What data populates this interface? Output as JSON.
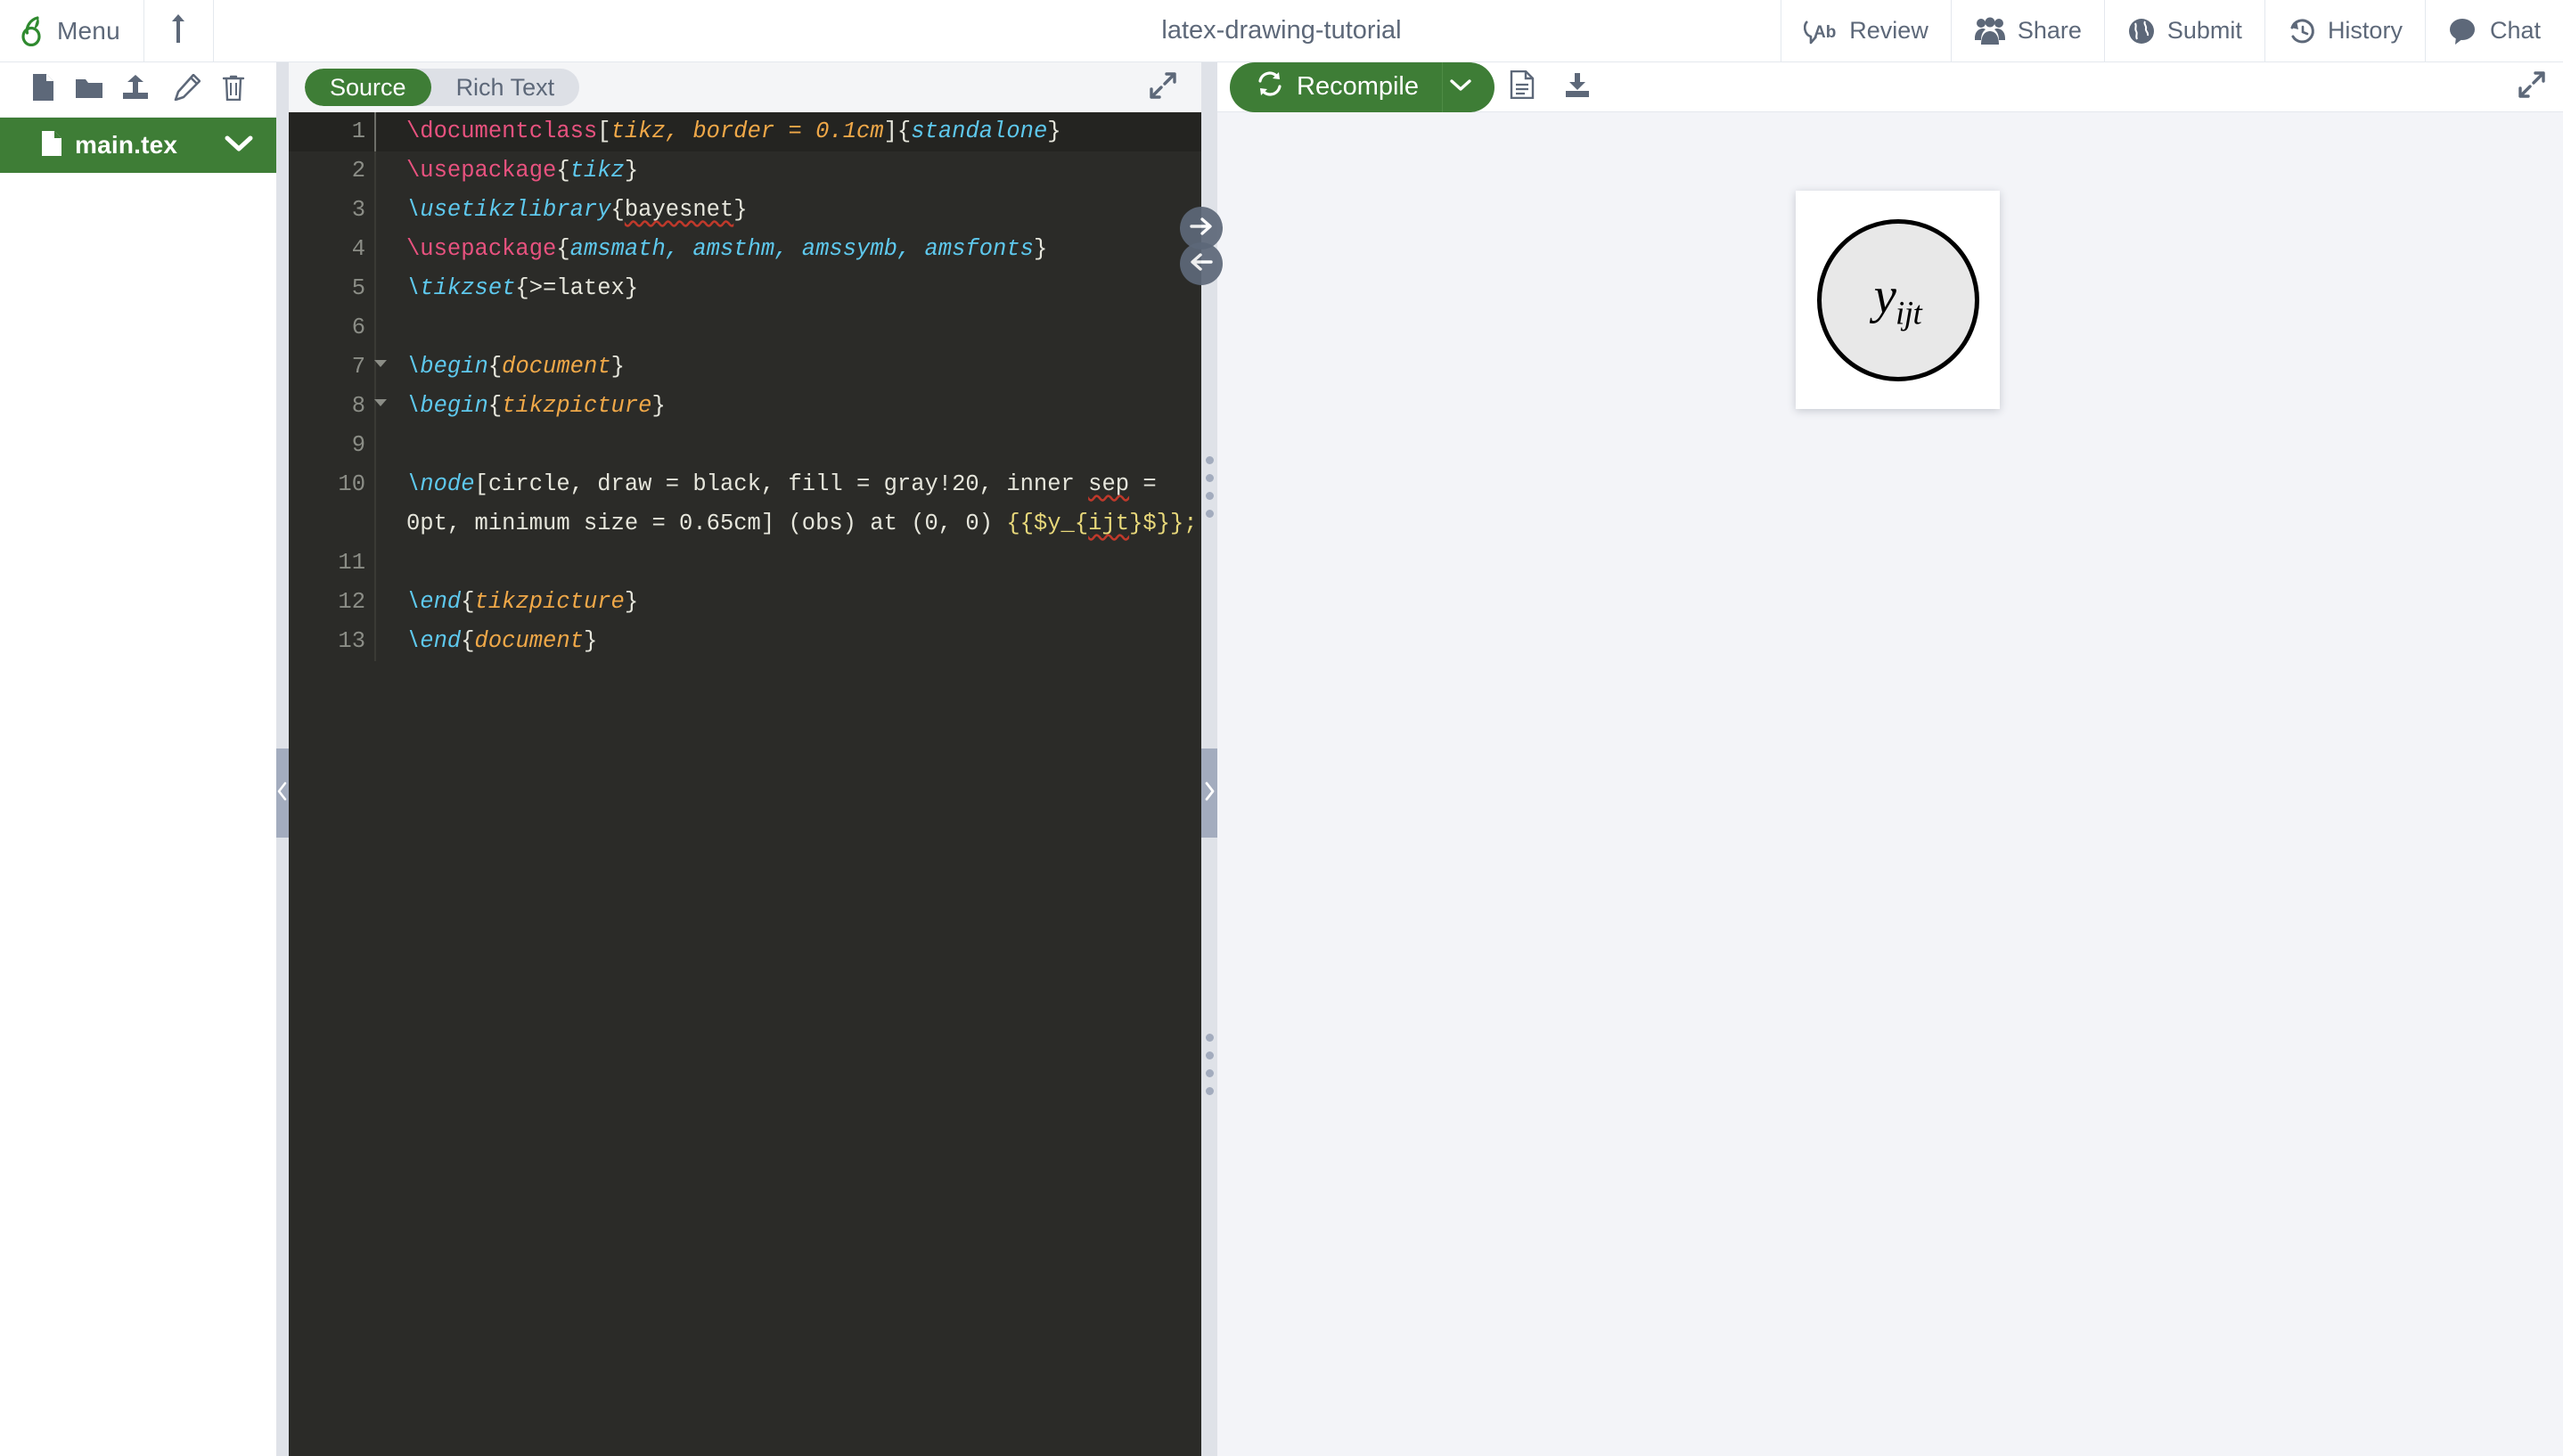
{
  "header": {
    "menu_label": "Menu",
    "project_title": "latex-drawing-tutorial",
    "logo_icon": "overleaf-logo-icon",
    "upload_icon": "upload-arrow-icon",
    "nav_items": [
      {
        "label": "Review",
        "icon": "review-ab-icon"
      },
      {
        "label": "Share",
        "icon": "share-people-icon"
      },
      {
        "label": "Submit",
        "icon": "submit-globe-icon"
      },
      {
        "label": "History",
        "icon": "history-clock-icon"
      },
      {
        "label": "Chat",
        "icon": "chat-bubble-icon"
      }
    ]
  },
  "file_panel": {
    "toolbar_icons": [
      {
        "name": "new-file-icon"
      },
      {
        "name": "new-folder-icon"
      },
      {
        "name": "upload-file-icon"
      },
      {
        "name": "rename-pencil-icon"
      },
      {
        "name": "delete-trash-icon"
      }
    ],
    "files": [
      {
        "name": "main.tex",
        "icon": "file-tex-icon",
        "selected": true
      }
    ]
  },
  "editor": {
    "tabs": [
      {
        "label": "Source",
        "active": true
      },
      {
        "label": "Rich Text",
        "active": false
      }
    ],
    "expand_icon": "expand-diagonal-icon",
    "sync_buttons": [
      {
        "name": "sync-to-pdf-button",
        "icon": "arrow-right-icon"
      },
      {
        "name": "sync-to-code-button",
        "icon": "arrow-left-icon"
      }
    ],
    "lines": [
      {
        "n": "1",
        "fold": false,
        "highlight": true,
        "tokens": [
          {
            "t": "\\documentclass",
            "c": "t-cmd"
          },
          {
            "t": "[",
            "c": "t-plain"
          },
          {
            "t": "tikz, border = 0.1cm",
            "c": "t-arg"
          },
          {
            "t": "]{",
            "c": "t-plain"
          },
          {
            "t": "standalone",
            "c": "t-arg2"
          },
          {
            "t": "}",
            "c": "t-plain"
          }
        ]
      },
      {
        "n": "2",
        "fold": false,
        "highlight": false,
        "tokens": [
          {
            "t": "\\usepackage",
            "c": "t-cmd"
          },
          {
            "t": "{",
            "c": "t-plain"
          },
          {
            "t": "tikz",
            "c": "t-arg2"
          },
          {
            "t": "}",
            "c": "t-plain"
          }
        ]
      },
      {
        "n": "3",
        "fold": false,
        "highlight": false,
        "tokens": [
          {
            "t": "\\usetikzlibrary",
            "c": "t-cmd2"
          },
          {
            "t": "{",
            "c": "t-plain"
          },
          {
            "t": "bayesnet",
            "c": "t-plain squig"
          },
          {
            "t": "}",
            "c": "t-plain"
          }
        ]
      },
      {
        "n": "4",
        "fold": false,
        "highlight": false,
        "tokens": [
          {
            "t": "\\usepackage",
            "c": "t-cmd"
          },
          {
            "t": "{",
            "c": "t-plain"
          },
          {
            "t": "amsmath, amsthm, amssymb, amsfonts",
            "c": "t-arg2"
          },
          {
            "t": "}",
            "c": "t-plain"
          }
        ]
      },
      {
        "n": "5",
        "fold": false,
        "highlight": false,
        "tokens": [
          {
            "t": "\\tikzset",
            "c": "t-cmd2"
          },
          {
            "t": "{>=latex}",
            "c": "t-plain"
          }
        ]
      },
      {
        "n": "6",
        "fold": false,
        "highlight": false,
        "tokens": []
      },
      {
        "n": "7",
        "fold": true,
        "highlight": false,
        "tokens": [
          {
            "t": "\\begin",
            "c": "t-cmd2"
          },
          {
            "t": "{",
            "c": "t-plain"
          },
          {
            "t": "document",
            "c": "t-arg"
          },
          {
            "t": "}",
            "c": "t-plain"
          }
        ]
      },
      {
        "n": "8",
        "fold": true,
        "highlight": false,
        "tokens": [
          {
            "t": "\\begin",
            "c": "t-cmd2"
          },
          {
            "t": "{",
            "c": "t-plain"
          },
          {
            "t": "tikzpicture",
            "c": "t-arg"
          },
          {
            "t": "}",
            "c": "t-plain"
          }
        ]
      },
      {
        "n": "9",
        "fold": false,
        "highlight": false,
        "tokens": []
      },
      {
        "n": "10",
        "fold": false,
        "highlight": false,
        "tokens": [
          {
            "t": "\\node",
            "c": "t-cmd2"
          },
          {
            "t": "[circle, draw = black, fill = gray!20, inner ",
            "c": "t-plain"
          },
          {
            "t": "sep",
            "c": "t-plain squig"
          },
          {
            "t": " = 0pt, minimum size = 0.65cm] (obs) at (0, 0) ",
            "c": "t-plain"
          },
          {
            "t": "{{$y_{",
            "c": "t-str"
          },
          {
            "t": "ijt",
            "c": "t-str squig"
          },
          {
            "t": "}$}};",
            "c": "t-str"
          }
        ]
      },
      {
        "n": "11",
        "fold": false,
        "highlight": false,
        "tokens": []
      },
      {
        "n": "12",
        "fold": false,
        "highlight": false,
        "tokens": [
          {
            "t": "\\end",
            "c": "t-cmd2"
          },
          {
            "t": "{",
            "c": "t-plain"
          },
          {
            "t": "tikzpicture",
            "c": "t-arg"
          },
          {
            "t": "}",
            "c": "t-plain"
          }
        ]
      },
      {
        "n": "13",
        "fold": false,
        "highlight": false,
        "tokens": [
          {
            "t": "\\end",
            "c": "t-cmd2"
          },
          {
            "t": "{",
            "c": "t-plain"
          },
          {
            "t": "document",
            "c": "t-arg"
          },
          {
            "t": "}",
            "c": "t-plain"
          }
        ]
      }
    ]
  },
  "pdf": {
    "recompile_label": "Recompile",
    "recompile_icon": "refresh-icon",
    "caret_icon": "chevron-down-icon",
    "logs_icon": "compile-logs-icon",
    "download_icon": "download-pdf-icon",
    "expand_icon": "expand-diagonal-icon",
    "rendered_node": {
      "base": "y",
      "subscript": "ijt"
    }
  },
  "colors": {
    "brand_green": "#3e7d36",
    "nav_text": "#5d6879",
    "editor_bg": "#2b2b28",
    "splitter": "#dfe2e8",
    "splitter_handle": "#a3acbe",
    "pdf_bg": "#f3f4f8"
  }
}
